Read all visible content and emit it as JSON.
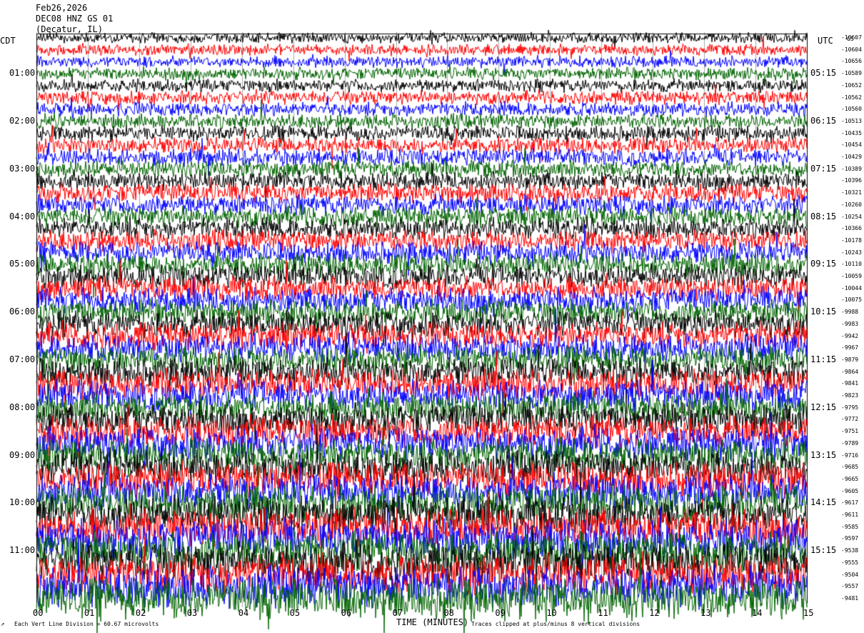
{
  "header": {
    "date": "Feb26,2026",
    "station": "DEC08 HNZ GS 01",
    "location": "(Decatur, IL)"
  },
  "left_axis_label": "CDT",
  "right_axis_label": "UTC",
  "corner_label": "GS",
  "footer": {
    "xlabel": "TIME (MINUTES)",
    "scale_note": "Each Vert Line Division = 60.67 microvolts",
    "clip_note": "Traces clipped at plus/minus 8 vertical divisions",
    "corner_mark": "↗"
  },
  "colors": {
    "trace_cycle": [
      "#000000",
      "#ff0000",
      "#0000ff",
      "#006400"
    ],
    "grid": "#000000",
    "background": "#ffffff"
  },
  "chart_data": {
    "type": "line",
    "title": "Feb26,2026 DEC08 HNZ GS 01 (Decatur, IL)",
    "xlabel": "TIME (MINUTES)",
    "x_ticks": [
      "00",
      "01",
      "02",
      "03",
      "04",
      "05",
      "06",
      "07",
      "08",
      "09",
      "10",
      "11",
      "12",
      "13",
      "14",
      "15"
    ],
    "xlim": [
      0,
      15
    ],
    "cdt_hour_labels": [
      "01:00",
      "02:00",
      "03:00",
      "04:00",
      "05:00",
      "06:00",
      "07:00",
      "08:00",
      "09:00",
      "10:00",
      "11:00"
    ],
    "utc_hour_labels": [
      "05:15",
      "06:15",
      "07:15",
      "08:15",
      "09:15",
      "10:15",
      "11:15",
      "12:15",
      "13:15",
      "14:15",
      "15:15"
    ],
    "trace_count": 48,
    "trace_interval_minutes": 15,
    "trace_offsets": [
      -10607,
      -10604,
      -10656,
      -10589,
      -10652,
      -10562,
      -10560,
      -10513,
      -10435,
      -10454,
      -10429,
      -10389,
      -10396,
      -10321,
      -10260,
      -10254,
      -10366,
      -10178,
      -10243,
      -10110,
      -10059,
      -10044,
      -10075,
      -9988,
      -9983,
      -9942,
      -9967,
      -9879,
      -9864,
      -9841,
      -9823,
      -9795,
      -9772,
      -9751,
      -9789,
      -9716,
      -9685,
      -9665,
      -9605,
      -9617,
      -9611,
      -9585,
      -9597,
      -9538,
      -9555,
      -9504,
      -9557,
      -9481
    ],
    "series": [
      {
        "name": "",
        "color": "black"
      },
      {
        "name": "",
        "color": "red"
      },
      {
        "name": "",
        "color": "blue"
      },
      {
        "name": "",
        "color": "green"
      }
    ],
    "grid": true
  }
}
